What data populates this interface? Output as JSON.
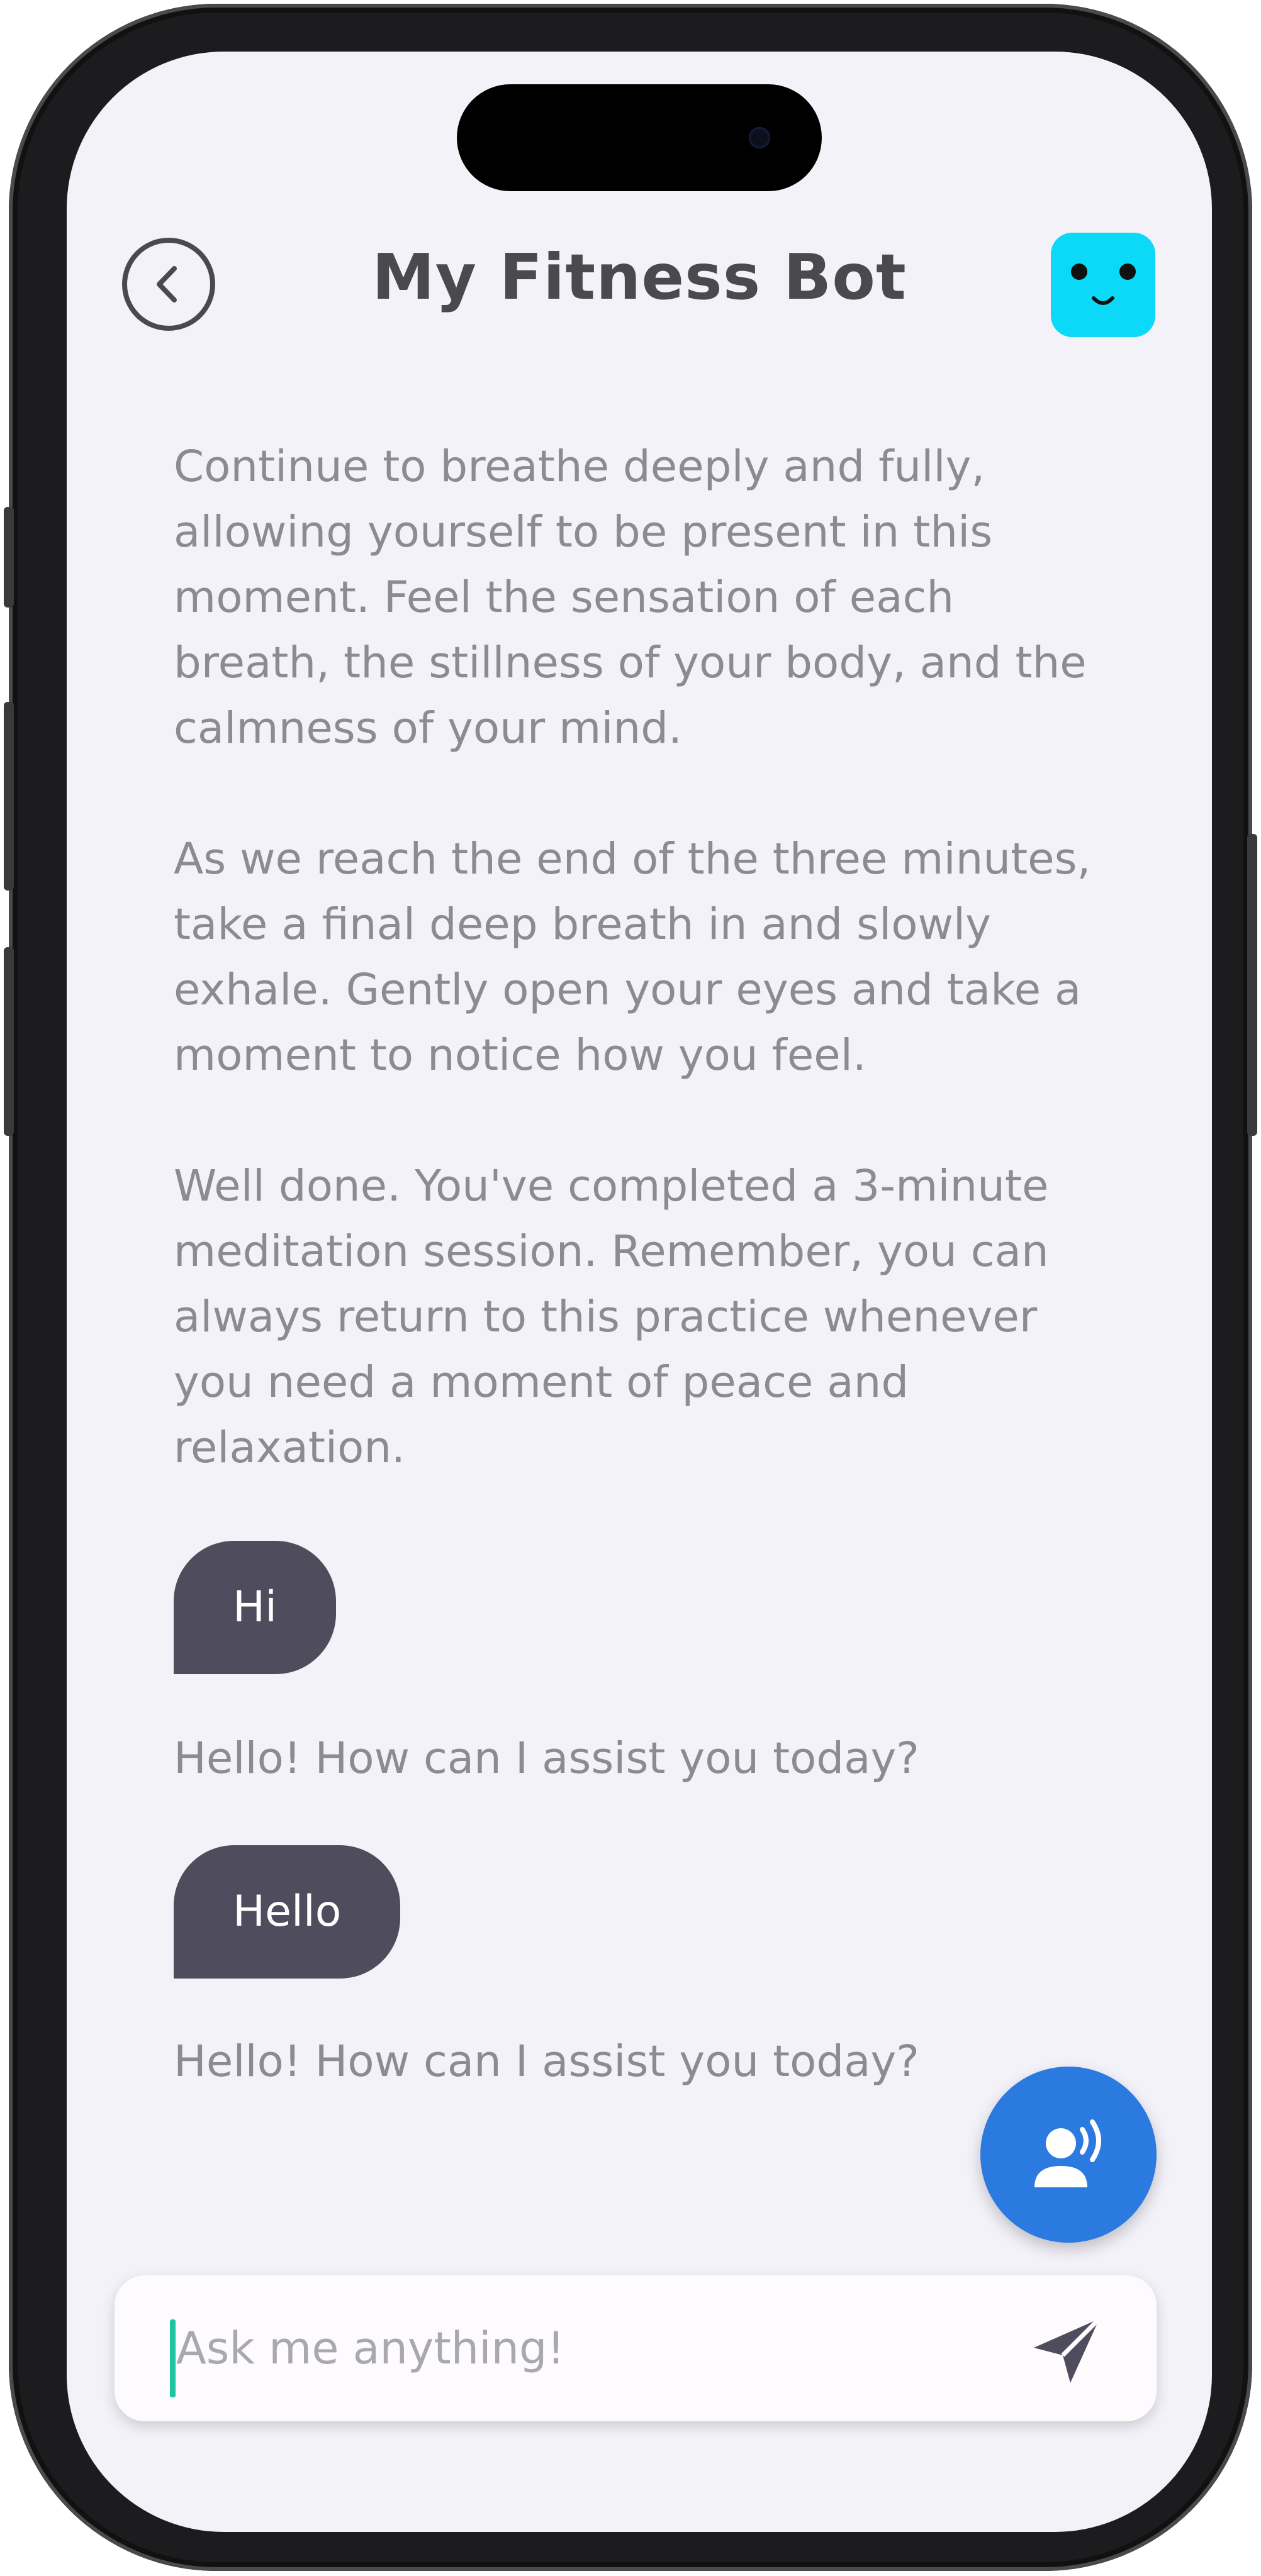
{
  "header": {
    "title": "My Fitness Bot"
  },
  "chat": {
    "bot_messages": [
      "Continue to breathe deeply and fully, allowing yourself to be present in this moment. Feel the sensation of each breath, the stillness of your body, and the calmness of your mind.",
      "As we reach the end of the three minutes, take a final deep breath in and slowly exhale. Gently open your eyes and take a moment to notice how you feel.",
      "Well done. You've completed a 3-minute meditation session. Remember, you can always return to this practice whenever you need a moment of peace and relaxation."
    ],
    "user_message_1": "Hi",
    "bot_reply_1": "Hello! How can I assist you today?",
    "user_message_2": "Hello",
    "bot_reply_2": "Hello! How can I assist you today?"
  },
  "input": {
    "placeholder": "Ask me anything!",
    "value": ""
  },
  "icons": {
    "back": "back-arrow-icon",
    "bot_avatar": "bot-face-icon",
    "voice": "voice-assistant-icon",
    "send": "send-icon"
  },
  "colors": {
    "background": "#f3f2f9",
    "user_bubble": "#4f4c5d",
    "bot_text": "#8c8b91",
    "title": "#4a4a4e",
    "avatar": "#0cd8f7",
    "voice_fab": "#2a7ae0",
    "caret": "#1fc4a3"
  }
}
